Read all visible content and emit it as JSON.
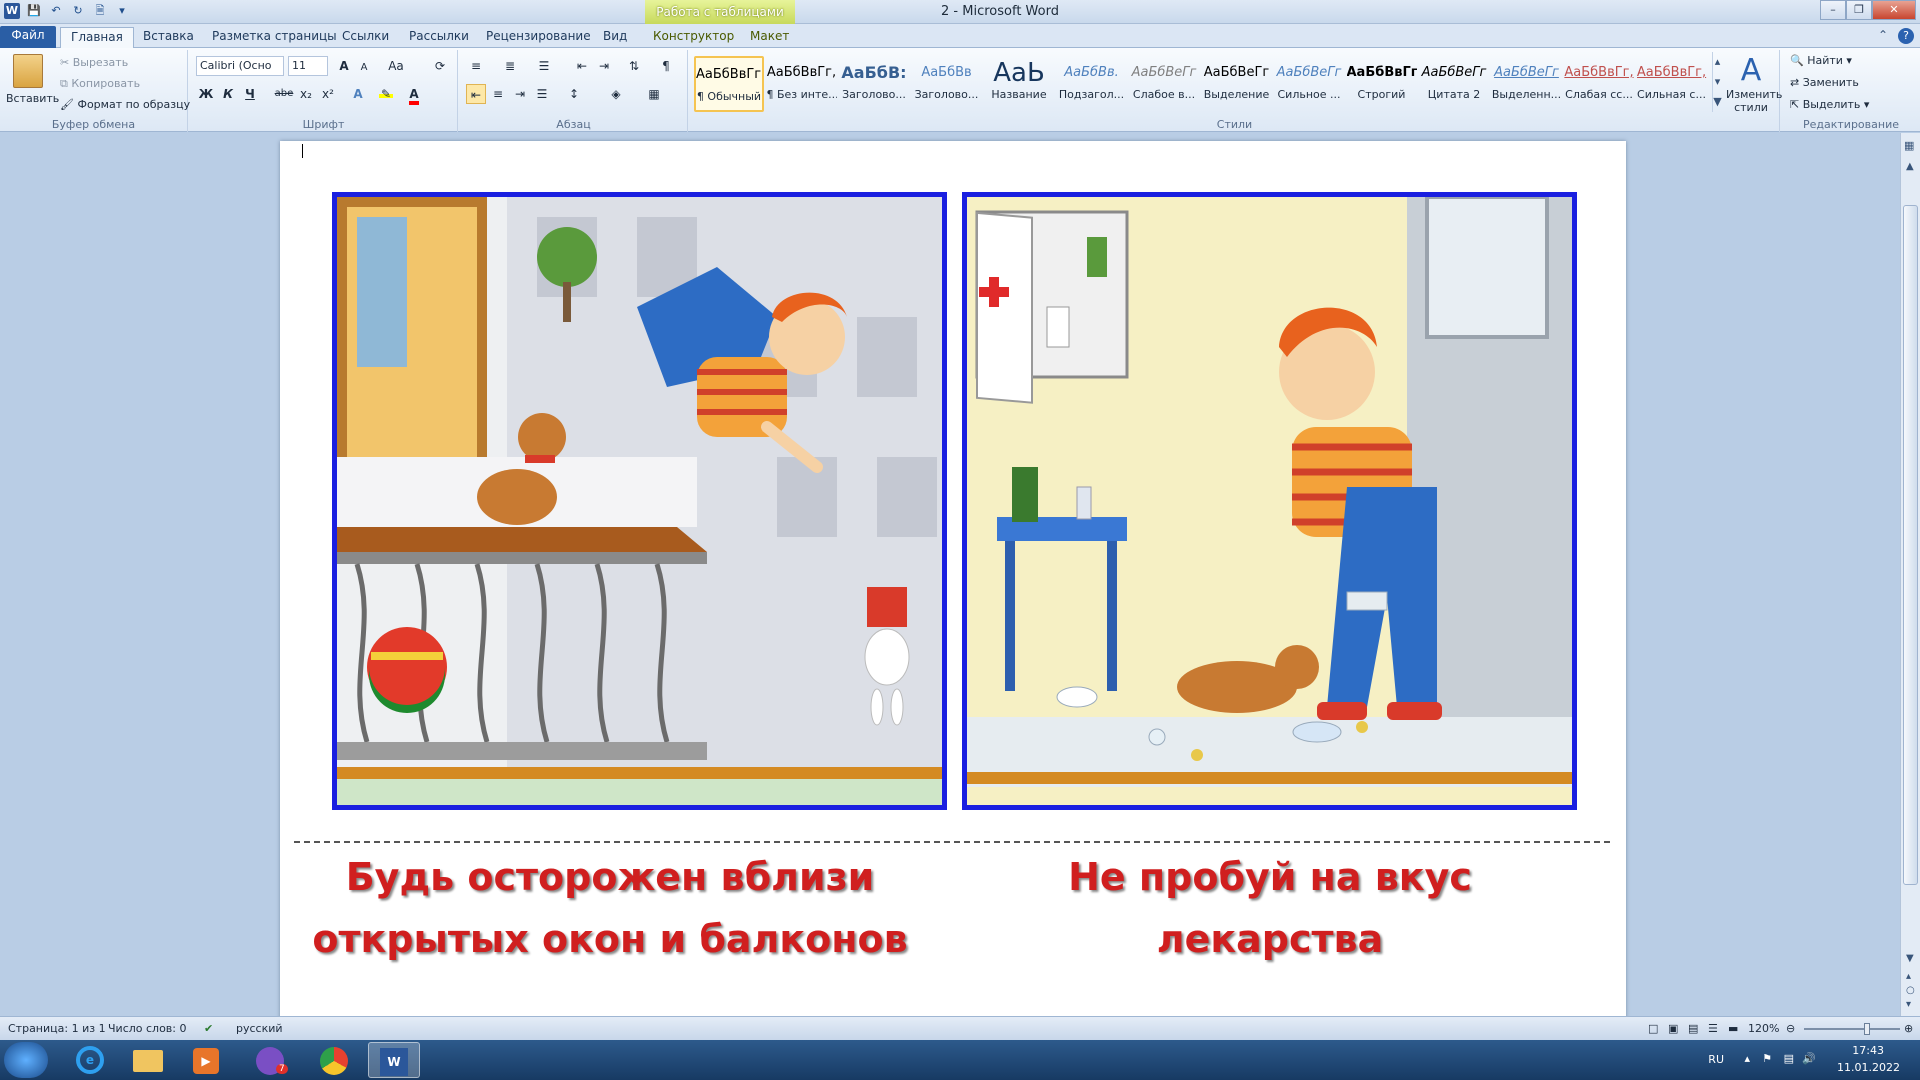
{
  "window": {
    "title": "2 - Microsoft Word",
    "context_tab_title": "Работа с таблицами"
  },
  "tabs": {
    "file": "Файл",
    "home": "Главная",
    "insert": "Вставка",
    "layout": "Разметка страницы",
    "references": "Ссылки",
    "mailings": "Рассылки",
    "review": "Рецензирование",
    "view": "Вид",
    "design": "Конструктор",
    "table_layout": "Макет"
  },
  "clipboard": {
    "paste": "Вставить",
    "cut": "Вырезать",
    "copy": "Копировать",
    "format_painter": "Формат по образцу",
    "group_label": "Буфер обмена"
  },
  "font": {
    "name": "Calibri (Осно",
    "size": "11",
    "bold": "Ж",
    "italic": "К",
    "underline": "Ч",
    "strike": "abe",
    "subscript": "x₂",
    "superscript": "x²",
    "grow": "A",
    "shrink": "A",
    "case": "Aa",
    "group_label": "Шрифт",
    "highlight_color": "#ffff00",
    "font_color": "#ff0000"
  },
  "paragraph": {
    "group_label": "Абзац"
  },
  "styles": {
    "items": [
      {
        "sample": "АаБбВвГг,",
        "name": "¶ Обычный",
        "color": "#000000"
      },
      {
        "sample": "АаБбВвГг,",
        "name": "¶ Без инте...",
        "color": "#000000"
      },
      {
        "sample": "АаБбВ:",
        "name": "Заголово...",
        "color": "#365f91"
      },
      {
        "sample": "АаБбВв",
        "name": "Заголово...",
        "color": "#4f81bd"
      },
      {
        "sample": "АаЬ",
        "name": "Название",
        "color": "#17365d"
      },
      {
        "sample": "АаБбВв.",
        "name": "Подзагол...",
        "color": "#4f81bd"
      },
      {
        "sample": "АаБбВеГг",
        "name": "Слабое в...",
        "color": "#808080"
      },
      {
        "sample": "АаБбВеГг",
        "name": "Выделение",
        "color": "#000000"
      },
      {
        "sample": "АаБбВеГг",
        "name": "Сильное ...",
        "color": "#4f81bd"
      },
      {
        "sample": "АаБбВвГг,",
        "name": "Строгий",
        "color": "#000000"
      },
      {
        "sample": "АаБбВеГг",
        "name": "Цитата 2",
        "color": "#000000"
      },
      {
        "sample": "АаБбВеГг",
        "name": "Выделенн...",
        "color": "#4f81bd"
      },
      {
        "sample": "АаБбВвГг,",
        "name": "Слабая сс...",
        "color": "#c0504d"
      },
      {
        "sample": "АаБбВвГг,",
        "name": "Сильная с...",
        "color": "#c0504d"
      }
    ],
    "change_styles": "Изменить стили",
    "group_label": "Стили"
  },
  "editing": {
    "find": "Найти",
    "replace": "Заменить",
    "select": "Выделить",
    "group_label": "Редактирование"
  },
  "document": {
    "caption_left_line1": "Будь осторожен вблизи",
    "caption_left_line2": "открытых окон и балконов",
    "caption_right_line1": "Не пробуй на вкус",
    "caption_right_line2": "лекарства",
    "caption_color": "#d01f1f",
    "frame_color": "#1a1fe0"
  },
  "statusbar": {
    "page": "Страница: 1 из 1",
    "words": "Число слов: 0",
    "language": "русский",
    "zoom": "120%"
  },
  "taskbar": {
    "lang": "RU",
    "time": "17:43",
    "date": "11.01.2022",
    "viber_badge": "7"
  }
}
